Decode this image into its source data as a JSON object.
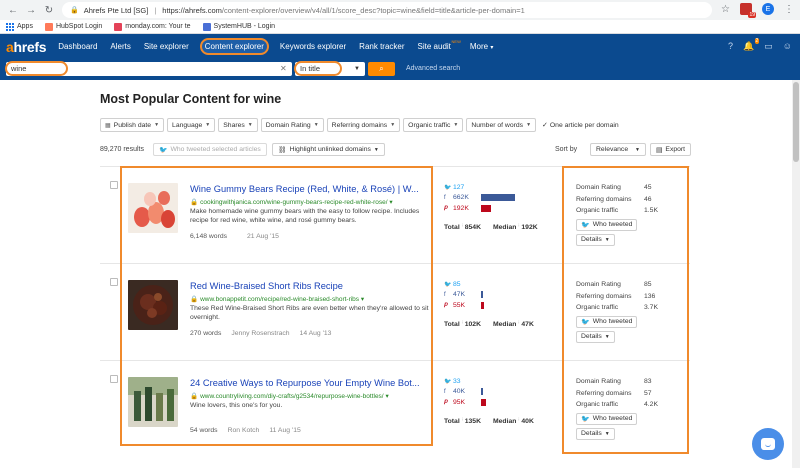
{
  "browser": {
    "site_label": "Ahrefs Pte Ltd [SG]",
    "url_host": "https://ahrefs.com",
    "url_path": "/content-explorer/overview/v4/all/1/score_desc?topic=wine&field=title&article-per-domain=1",
    "bookmarks": [
      "Apps",
      "HubSpot Login",
      "monday.com: Your te",
      "SystemHUB - Login"
    ],
    "profile_initial": "E",
    "ext_badge": "19"
  },
  "nav": {
    "logo_a": "a",
    "logo_rest": "hrefs",
    "items": [
      "Dashboard",
      "Alerts",
      "Site explorer",
      "Content explorer",
      "Keywords explorer",
      "Rank tracker",
      "Site audit",
      "More"
    ],
    "new_badge": "NEW",
    "more_caret": "▾",
    "notif_count": "2"
  },
  "search": {
    "query": "wine",
    "mode": "In title",
    "advanced": "Advanced search"
  },
  "page": {
    "title": "Most Popular Content for wine",
    "filters": [
      "Publish date",
      "Language",
      "Shares",
      "Domain Rating",
      "Referring domains",
      "Organic traffic",
      "Number of words"
    ],
    "one_per_domain": "One article per domain",
    "results_count": "89,270 results",
    "who_tweeted_selected": "Who tweeted selected articles",
    "highlight_unlinked": "Highlight unlinked domains",
    "sort_by_label": "Sort by",
    "sort_value": "Relevance",
    "export": "Export"
  },
  "labels": {
    "total": "Total",
    "median": "Median",
    "domain_rating": "Domain Rating",
    "referring_domains": "Referring domains",
    "organic_traffic": "Organic traffic",
    "who_tweeted": "Who tweeted",
    "details": "Details"
  },
  "articles": [
    {
      "title": "Wine Gummy Bears Recipe (Red, White, & Rosé) | W...",
      "url": "cookingwithjanica.com/wine-gummy-bears-recipe-red-white-rose/",
      "desc": "Make homemade wine gummy bears with the easy to follow recipe. Includes recipe for red wine, white wine, and rosé gummy bears.",
      "words": "6,148 words",
      "author": "",
      "date": "21 Aug '15",
      "twitter": "127",
      "facebook": "662K",
      "pinterest": "192K",
      "fb_share": 1.0,
      "pi_share": 0.29,
      "total": "854K",
      "median": "192K",
      "domain_rating": "45",
      "referring_domains": "46",
      "organic_traffic": "1.5K"
    },
    {
      "title": "Red Wine-Braised Short Ribs Recipe",
      "url": "www.bonappetit.com/recipe/red-wine-braised-short-ribs",
      "desc": "These Red Wine-Braised Short Ribs are even better when they're allowed to sit overnight.",
      "words": "270 words",
      "author": "Jenny Rosenstrach",
      "date": "14 Aug '13",
      "twitter": "85",
      "facebook": "47K",
      "pinterest": "55K",
      "fb_share": 0.07,
      "pi_share": 0.08,
      "total": "102K",
      "median": "47K",
      "domain_rating": "85",
      "referring_domains": "136",
      "organic_traffic": "3.7K"
    },
    {
      "title": "24 Creative Ways to Repurpose Your Empty Wine Bot...",
      "url": "www.countryliving.com/diy-crafts/g2534/repurpose-wine-bottles/",
      "desc": "Wine lovers, this one's for you.",
      "words": "54 words",
      "author": "Ron Kotch",
      "date": "11 Aug '15",
      "twitter": "33",
      "facebook": "40K",
      "pinterest": "95K",
      "fb_share": 0.06,
      "pi_share": 0.14,
      "total": "135K",
      "median": "40K",
      "domain_rating": "83",
      "referring_domains": "57",
      "organic_traffic": "4.2K"
    }
  ]
}
